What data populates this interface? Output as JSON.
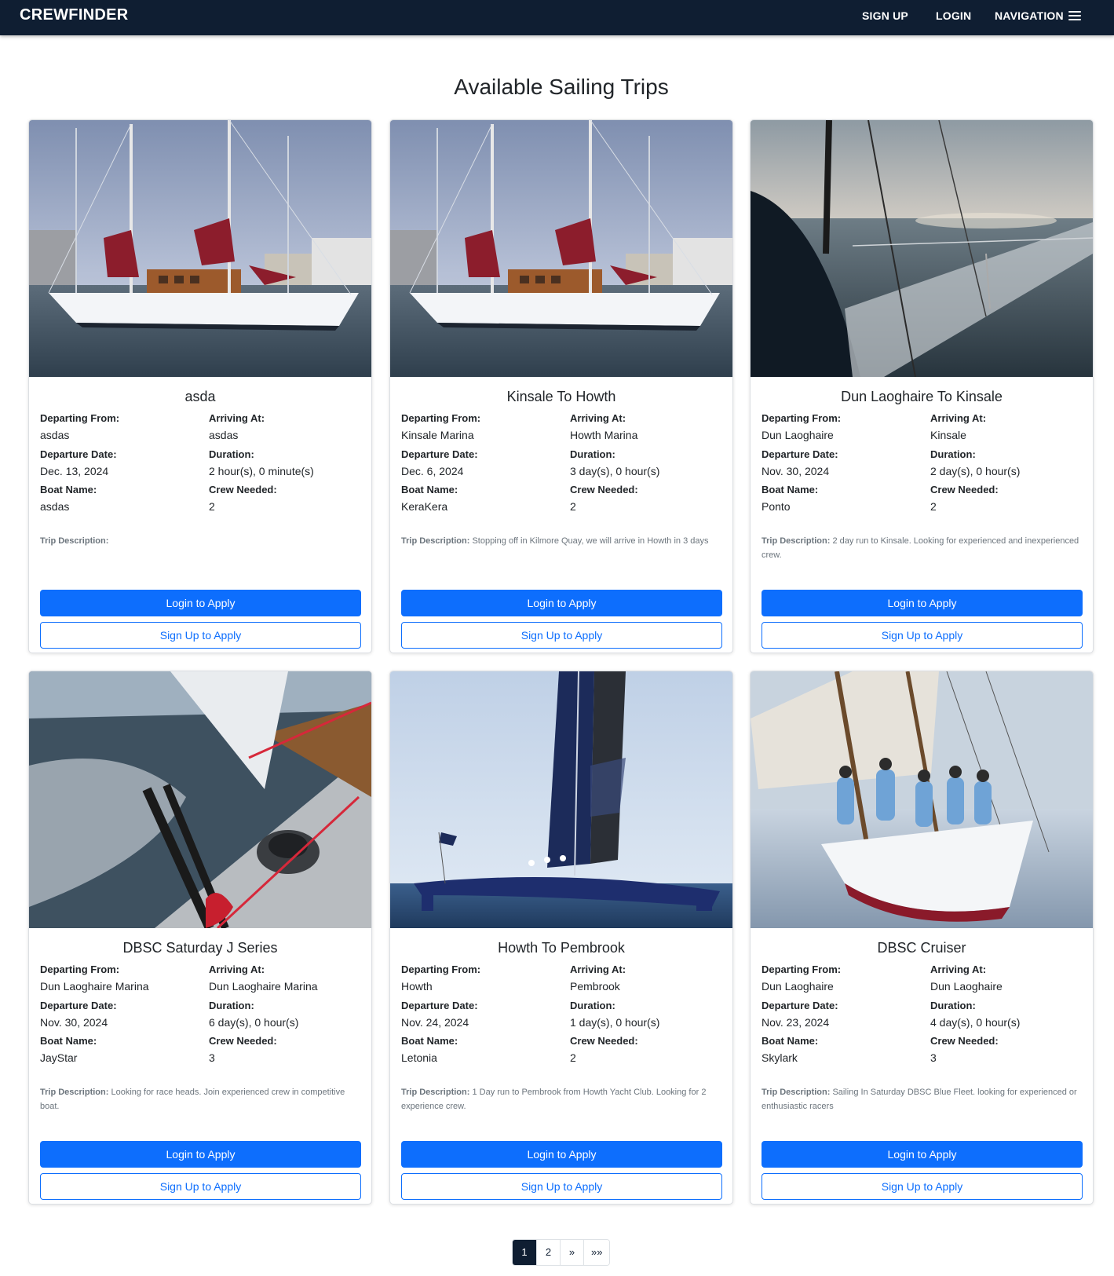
{
  "navbar": {
    "brand": "CREWFINDER",
    "links": {
      "signup": "SIGN UP",
      "login": "LOGIN",
      "navigation": "NAVIGATION"
    },
    "menu_icon": "hamburger-menu-icon",
    "background": "#0f1e32"
  },
  "page_title": "Available Sailing Trips",
  "labels": {
    "departing_from": "Departing From:",
    "arriving_at": "Arriving At:",
    "departure_date": "Departure Date:",
    "duration": "Duration:",
    "boat_name": "Boat Name:",
    "crew_needed": "Crew Needed:",
    "trip_description": "Trip Description:",
    "login_to_apply": "Login to Apply",
    "signup_to_apply": "Sign Up to Apply"
  },
  "trips": [
    {
      "title": "asda",
      "departing_from": "asdas",
      "arriving_at": "asdas",
      "departure_date": "Dec. 13, 2024",
      "duration": "2 hour(s), 0 minute(s)",
      "boat_name": "asdas",
      "crew_needed": "2",
      "description": "",
      "image": "sailboat-marina-photo"
    },
    {
      "title": "Kinsale To Howth",
      "departing_from": "Kinsale Marina",
      "arriving_at": "Howth Marina",
      "departure_date": "Dec. 6, 2024",
      "duration": "3 day(s), 0 hour(s)",
      "boat_name": "KeraKera",
      "crew_needed": "2",
      "description": "Stopping off in Kilmore Quay, we will arrive in Howth in 3 days",
      "image": "sailboat-marina-photo"
    },
    {
      "title": "Dun Laoghaire To Kinsale",
      "departing_from": "Dun Laoghaire",
      "arriving_at": "Kinsale",
      "departure_date": "Nov. 30, 2024",
      "duration": "2 day(s), 0 hour(s)",
      "boat_name": "Ponto",
      "crew_needed": "2",
      "description": "2 day run to Kinsale. Looking for experienced and inexperienced crew.",
      "image": "sea-sunset-photo"
    },
    {
      "title": "DBSC Saturday J Series",
      "departing_from": "Dun Laoghaire Marina",
      "arriving_at": "Dun Laoghaire Marina",
      "departure_date": "Nov. 30, 2024",
      "duration": "6 day(s), 0 hour(s)",
      "boat_name": "JayStar",
      "crew_needed": "3",
      "description": "Looking for race heads. Join experienced crew in competitive boat.",
      "image": "winch-deck-photo"
    },
    {
      "title": "Howth To Pembrook",
      "departing_from": "Howth",
      "arriving_at": "Pembrook",
      "departure_date": "Nov. 24, 2024",
      "duration": "1 day(s), 0 hour(s)",
      "boat_name": "Letonia",
      "crew_needed": "2",
      "description": "1 Day run to Pembrook from Howth Yacht Club. Looking for 2 experience crew.",
      "image": "racing-trimaran-photo"
    },
    {
      "title": "DBSC Cruiser",
      "departing_from": "Dun Laoghaire",
      "arriving_at": "Dun Laoghaire",
      "departure_date": "Nov. 23, 2024",
      "duration": "4 day(s), 0 hour(s)",
      "boat_name": "Skylark",
      "crew_needed": "3",
      "description": "Sailing In Saturday DBSC Blue Fleet. looking for experienced or enthusiastic racers",
      "image": "crewed-yacht-photo"
    }
  ],
  "pagination": {
    "pages": [
      "1",
      "2"
    ],
    "current": "1",
    "next": "»",
    "last": "»»"
  },
  "colors": {
    "primary": "#0d6efd",
    "navbar": "#0f1e32",
    "muted": "#6c757d"
  }
}
